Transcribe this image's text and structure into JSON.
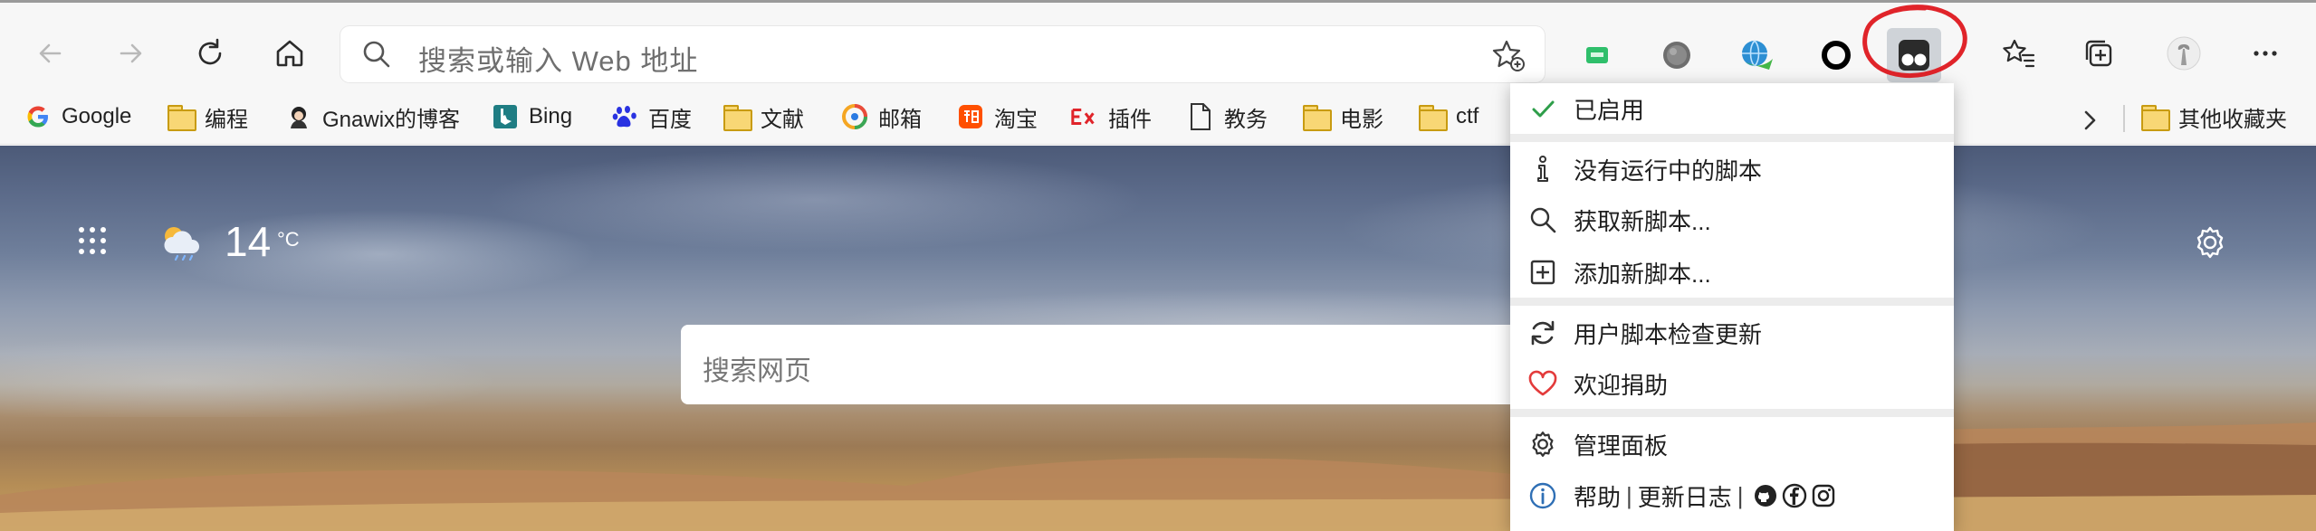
{
  "toolbar": {
    "address_placeholder": "搜索或输入 Web 地址",
    "buttons": [
      {
        "name": "back-button",
        "icon": "arrow-left-icon"
      },
      {
        "name": "forward-button",
        "icon": "arrow-right-icon"
      },
      {
        "name": "refresh-button",
        "icon": "refresh-icon"
      },
      {
        "name": "home-button",
        "icon": "home-icon"
      }
    ],
    "extensions": [
      {
        "name": "extension-green",
        "icon": "green-badge-icon"
      },
      {
        "name": "extension-gray",
        "icon": "gray-ball-icon"
      },
      {
        "name": "extension-idm",
        "icon": "idm-globe-icon"
      },
      {
        "name": "extension-circle",
        "icon": "ring-icon"
      },
      {
        "name": "extension-tampermonkey",
        "icon": "tampermonkey-icon"
      }
    ],
    "right_buttons": [
      {
        "name": "favorites-button",
        "icon": "favorites-list-icon"
      },
      {
        "name": "collections-button",
        "icon": "collections-icon"
      },
      {
        "name": "profile-button",
        "icon": "avatar"
      },
      {
        "name": "more-button",
        "icon": "more-icon"
      }
    ],
    "annotation_color": "#e0242a"
  },
  "bookmarks": {
    "items": [
      {
        "label": "Google",
        "icon": "google-icon"
      },
      {
        "label": "编程",
        "icon": "folder-icon"
      },
      {
        "label": "Gnawix的博客",
        "icon": "blog-avatar-icon"
      },
      {
        "label": "Bing",
        "icon": "bing-icon"
      },
      {
        "label": "百度",
        "icon": "baidu-icon"
      },
      {
        "label": "文献",
        "icon": "folder-icon"
      },
      {
        "label": "邮箱",
        "icon": "mail-icon"
      },
      {
        "label": "淘宝",
        "icon": "taobao-icon"
      },
      {
        "label": "插件",
        "icon": "ex-icon"
      },
      {
        "label": "教务",
        "icon": "document-icon"
      },
      {
        "label": "电影",
        "icon": "folder-icon"
      },
      {
        "label": "ctf",
        "icon": "folder-icon"
      }
    ],
    "other_favorites": "其他收藏夹"
  },
  "newtab": {
    "temperature": "14",
    "temperature_unit": "°C",
    "search_placeholder": "搜索网页"
  },
  "tampermonkey_menu": {
    "enabled": "已启用",
    "no_scripts": "没有运行中的脚本",
    "get_scripts": "获取新脚本...",
    "add_script": "添加新脚本...",
    "check_updates": "用户脚本检查更新",
    "donate": "欢迎捐助",
    "dashboard": "管理面板",
    "help": "帮助",
    "changelog": "更新日志",
    "link_separator": "|",
    "colors": {
      "check": "#2e9e4a",
      "heart": "#e33b3b",
      "info": "#2f6fb5"
    }
  }
}
